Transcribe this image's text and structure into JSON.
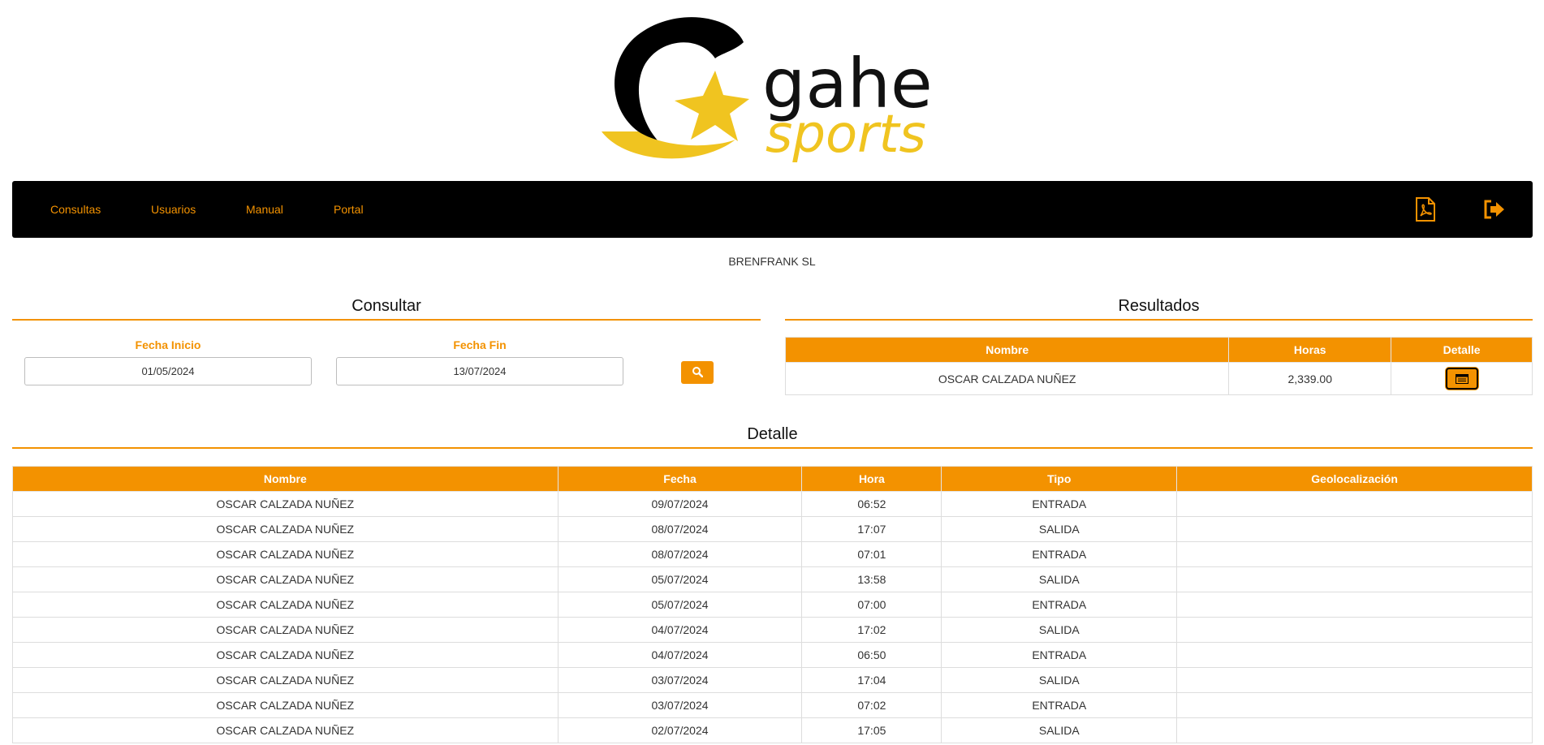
{
  "brand": {
    "logo_text_top": "gahe",
    "logo_text_bottom": "sports"
  },
  "nav": {
    "items": [
      {
        "label": "Consultas"
      },
      {
        "label": "Usuarios"
      },
      {
        "label": "Manual"
      },
      {
        "label": "Portal"
      }
    ],
    "icons": [
      "pdf-icon",
      "logout-icon"
    ]
  },
  "company": "BRENFRANK SL",
  "consultar": {
    "title": "Consultar",
    "start_label": "Fecha Inicio",
    "start_value": "01/05/2024",
    "end_label": "Fecha Fin",
    "end_value": "13/07/2024",
    "search_icon": "search-icon"
  },
  "resultados": {
    "title": "Resultados",
    "headers": [
      "Nombre",
      "Horas",
      "Detalle"
    ],
    "rows": [
      {
        "nombre": "OSCAR CALZADA NUÑEZ",
        "horas": "2,339.00",
        "detalle_icon": "list-icon"
      }
    ]
  },
  "detalle": {
    "title": "Detalle",
    "headers": [
      "Nombre",
      "Fecha",
      "Hora",
      "Tipo",
      "Geolocalización"
    ],
    "rows": [
      {
        "nombre": "OSCAR CALZADA NUÑEZ",
        "fecha": "09/07/2024",
        "hora": "06:52",
        "tipo": "ENTRADA",
        "geo": ""
      },
      {
        "nombre": "OSCAR CALZADA NUÑEZ",
        "fecha": "08/07/2024",
        "hora": "17:07",
        "tipo": "SALIDA",
        "geo": ""
      },
      {
        "nombre": "OSCAR CALZADA NUÑEZ",
        "fecha": "08/07/2024",
        "hora": "07:01",
        "tipo": "ENTRADA",
        "geo": ""
      },
      {
        "nombre": "OSCAR CALZADA NUÑEZ",
        "fecha": "05/07/2024",
        "hora": "13:58",
        "tipo": "SALIDA",
        "geo": ""
      },
      {
        "nombre": "OSCAR CALZADA NUÑEZ",
        "fecha": "05/07/2024",
        "hora": "07:00",
        "tipo": "ENTRADA",
        "geo": ""
      },
      {
        "nombre": "OSCAR CALZADA NUÑEZ",
        "fecha": "04/07/2024",
        "hora": "17:02",
        "tipo": "SALIDA",
        "geo": ""
      },
      {
        "nombre": "OSCAR CALZADA NUÑEZ",
        "fecha": "04/07/2024",
        "hora": "06:50",
        "tipo": "ENTRADA",
        "geo": ""
      },
      {
        "nombre": "OSCAR CALZADA NUÑEZ",
        "fecha": "03/07/2024",
        "hora": "17:04",
        "tipo": "SALIDA",
        "geo": ""
      },
      {
        "nombre": "OSCAR CALZADA NUÑEZ",
        "fecha": "03/07/2024",
        "hora": "07:02",
        "tipo": "ENTRADA",
        "geo": ""
      },
      {
        "nombre": "OSCAR CALZADA NUÑEZ",
        "fecha": "02/07/2024",
        "hora": "17:05",
        "tipo": "SALIDA",
        "geo": ""
      }
    ]
  },
  "colors": {
    "accent": "#f39200",
    "nav_bg": "#000000",
    "logo_yellow": "#f0c420"
  }
}
